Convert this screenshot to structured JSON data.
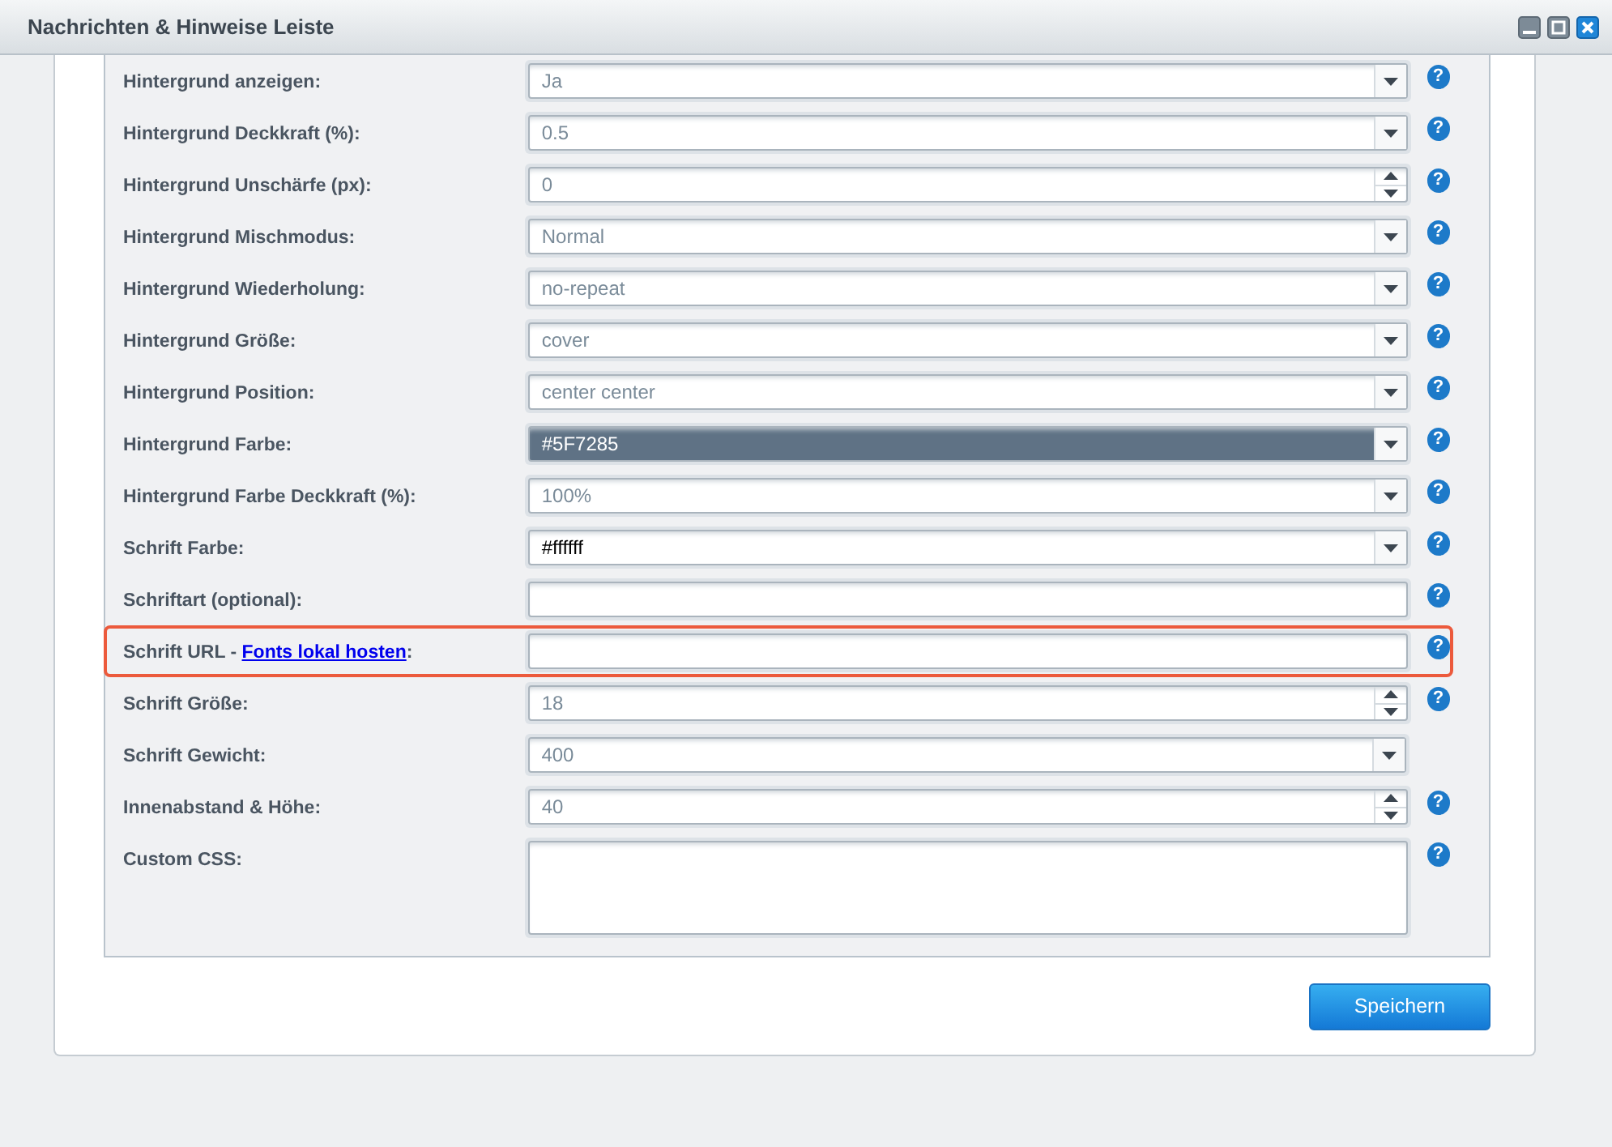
{
  "window": {
    "title": "Nachrichten & Hinweise Leiste"
  },
  "rows": [
    {
      "label": "Hintergrund anzeigen:",
      "kind": "select",
      "value": "Ja",
      "help": "?",
      "highlighted": false
    },
    {
      "label": "Hintergrund Deckkraft (%):",
      "kind": "select",
      "value": "0.5",
      "help": "?",
      "highlighted": false
    },
    {
      "label": "Hintergrund Unschärfe (px):",
      "kind": "number",
      "value": "0",
      "help": "?",
      "highlighted": false
    },
    {
      "label": "Hintergrund Mischmodus:",
      "kind": "select",
      "value": "Normal",
      "help": "?",
      "highlighted": false
    },
    {
      "label": "Hintergrund Wiederholung:",
      "kind": "select",
      "value": "no-repeat",
      "help": "?",
      "highlighted": false
    },
    {
      "label": "Hintergrund Größe:",
      "kind": "select",
      "value": "cover",
      "help": "?",
      "highlighted": false
    },
    {
      "label": "Hintergrund Position:",
      "kind": "select",
      "value": "center center",
      "help": "?",
      "highlighted": false
    },
    {
      "label": "Hintergrund Farbe:",
      "kind": "select",
      "value": "#5F7285",
      "color": "#5f7285",
      "help": "?",
      "highlighted": false
    },
    {
      "label": "Hintergrund Farbe Deckkraft (%):",
      "kind": "select",
      "value": "100%",
      "help": "?",
      "highlighted": false
    },
    {
      "label": "Schrift Farbe:",
      "kind": "select",
      "value": "#ffffff",
      "color": "#ffffff",
      "help": "?",
      "highlighted": false
    },
    {
      "label": "Schriftart (optional):",
      "kind": "text",
      "help": "?",
      "highlighted": false
    },
    {
      "label": "Schrift URL - ",
      "link": "Fonts lokal hosten",
      "suffix": ":",
      "kind": "text",
      "help": "?",
      "highlighted": true
    },
    {
      "label": "Schrift Größe:",
      "kind": "number",
      "value": "18",
      "help": "?",
      "highlighted": false
    },
    {
      "label": "Schrift Gewicht:",
      "kind": "select",
      "value": "400",
      "highlighted": false
    },
    {
      "label": "Innenabstand & Höhe:",
      "kind": "number",
      "value": "40",
      "help": "?",
      "highlighted": false
    },
    {
      "label": "Custom CSS:",
      "kind": "textarea",
      "help": "?",
      "highlighted": false
    }
  ],
  "save_button": "Speichern"
}
